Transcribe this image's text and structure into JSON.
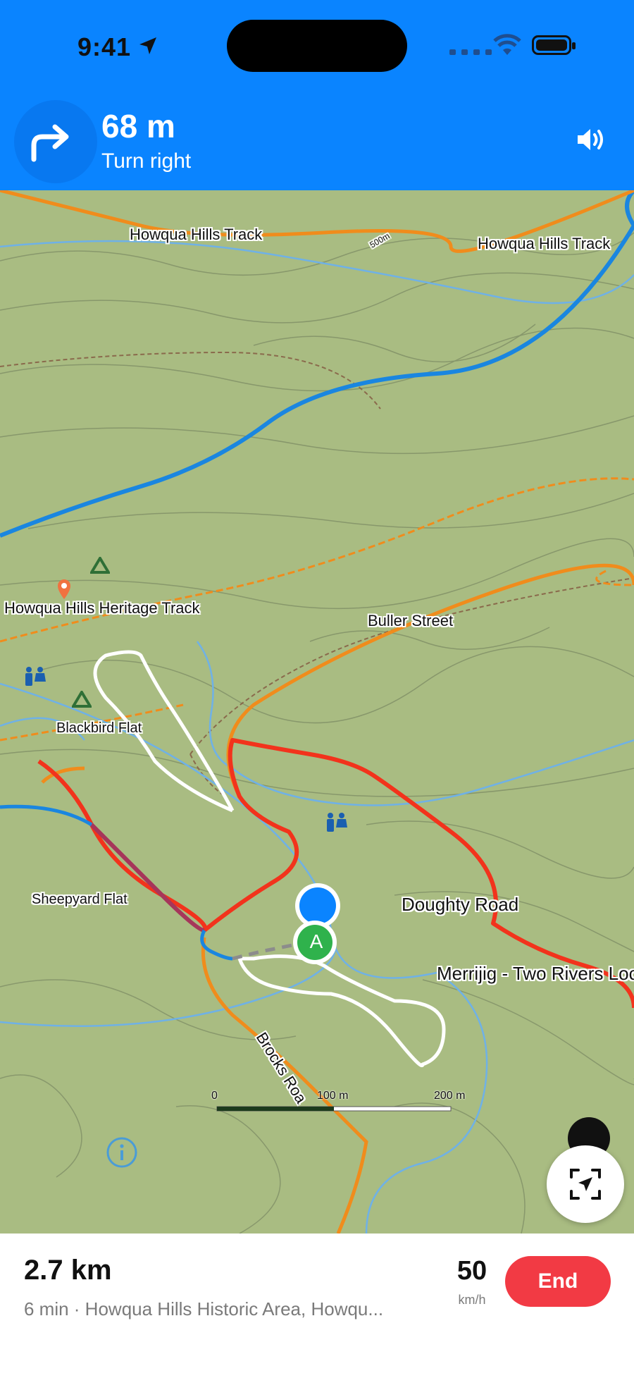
{
  "status_bar": {
    "time": "9:41"
  },
  "navigation": {
    "distance": "68 m",
    "instruction": "Turn right"
  },
  "map_labels": {
    "track_top_left": "Howqua Hills Track",
    "track_top_right": "Howqua Hills Track",
    "heritage_track": "Howqua Hills Heritage Track",
    "buller_street": "Buller Street",
    "blackbird_flat": "Blackbird Flat",
    "sheepyard_flat": "Sheepyard Flat",
    "doughty_road": "Doughty Road",
    "merrijig_road": "Merrijig - Two Rivers Loc",
    "brocks_road": "Brocks Roa",
    "contour_500": "500m",
    "start_marker": "A"
  },
  "scale_bar": {
    "tick_0": "0",
    "tick_100": "100 m",
    "tick_200": "200 m"
  },
  "trip": {
    "remaining_distance": "2.7 km",
    "eta_destination": "6 min · Howqua Hills Historic Area, Howqu...",
    "speed_limit": "50",
    "speed_unit": "km/h",
    "end_label": "End"
  },
  "colors": {
    "banner_blue": "#0a84ff",
    "map_green": "#a9bc82",
    "route_red": "#f2331c",
    "road_orange": "#f08c1c",
    "end_red": "#f23a44"
  }
}
